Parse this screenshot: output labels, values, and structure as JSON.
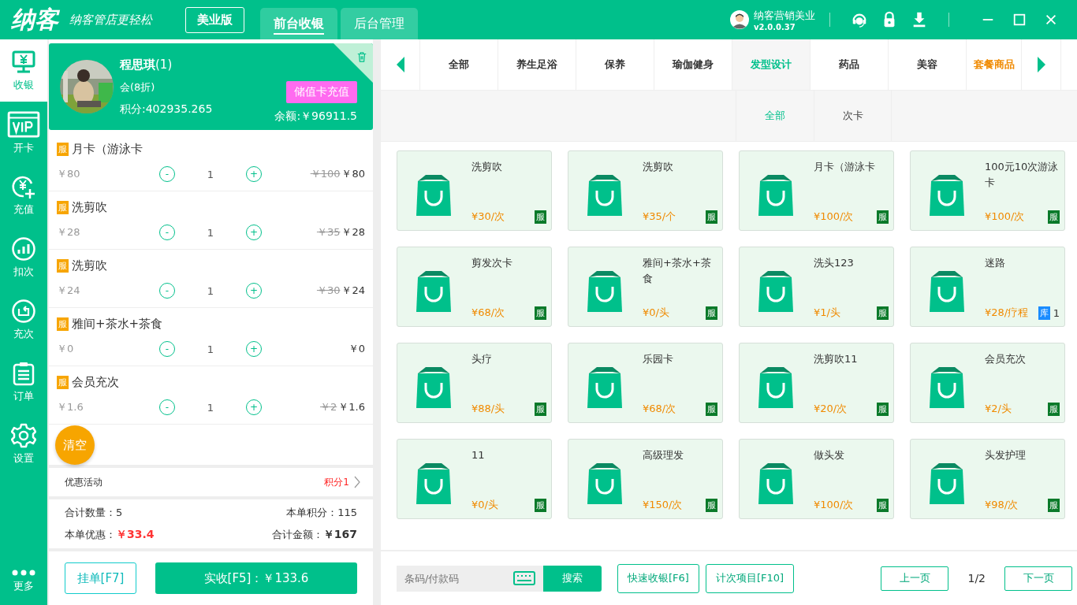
{
  "header": {
    "logo": "纳客",
    "slogan": "纳客管店更轻松",
    "edition": "美业版",
    "tabs": [
      {
        "label": "前台收银",
        "selected": true
      },
      {
        "label": "后台管理",
        "selected": false
      }
    ],
    "user": {
      "name": "纳客营销美业",
      "version": "v2.0.0.37"
    }
  },
  "nav": [
    {
      "label": "收银",
      "selected": true
    },
    {
      "label": "开卡",
      "selected": false
    },
    {
      "label": "充值",
      "selected": false
    },
    {
      "label": "扣次",
      "selected": false
    },
    {
      "label": "充次",
      "selected": false
    },
    {
      "label": "订单",
      "selected": false
    },
    {
      "label": "设置",
      "selected": false
    }
  ],
  "nav_more": "更多",
  "member": {
    "name": "程思琪",
    "count": "(1)",
    "level": "会(8折)",
    "recharge_button": "储值卡充值",
    "points": "积分:402935.265",
    "balance": "余额:￥96911.5"
  },
  "cart": [
    {
      "tag": "服",
      "name": "月卡（游泳卡",
      "unit_price": "￥80",
      "qty": "1",
      "original": "￥100",
      "price": "￥80"
    },
    {
      "tag": "服",
      "name": "洗剪吹",
      "unit_price": "￥28",
      "qty": "1",
      "original": "￥35",
      "price": "￥28"
    },
    {
      "tag": "服",
      "name": "洗剪吹",
      "unit_price": "￥24",
      "qty": "1",
      "original": "￥30",
      "price": "￥24"
    },
    {
      "tag": "服",
      "name": "雅间+茶水+茶食",
      "unit_price": "￥0",
      "qty": "1",
      "price": "￥0"
    },
    {
      "tag": "服",
      "name": "会员充次",
      "unit_price": "￥1.6",
      "qty": "1",
      "original": "￥2",
      "price": "￥1.6"
    }
  ],
  "minus": "-",
  "plus": "+",
  "clear_button": "清空",
  "promotion": {
    "label": "优惠活动",
    "value": "积分1"
  },
  "summary": {
    "qty_label": "合计数量：5",
    "points_label": "本单积分：115",
    "discount_label": "本单优惠：",
    "discount": "￥33.4",
    "total_label": "合计金额：",
    "total": "￥167"
  },
  "hold_button": "挂单[F7]",
  "pay_button": "实收[F5]：￥133.6",
  "categories": [
    {
      "label": "全部",
      "kind": "normal",
      "selected": false
    },
    {
      "label": "养生足浴",
      "kind": "normal",
      "selected": false
    },
    {
      "label": "保养",
      "kind": "normal",
      "selected": false
    },
    {
      "label": "瑜伽健身",
      "kind": "normal",
      "selected": false
    },
    {
      "label": "发型设计",
      "kind": "normal",
      "selected": true
    },
    {
      "label": "药品",
      "kind": "normal",
      "selected": false
    },
    {
      "label": "美容",
      "kind": "normal",
      "selected": false
    },
    {
      "label": "套餐商品",
      "kind": "package",
      "selected": false
    }
  ],
  "subcategories": [
    {
      "label": "全部",
      "selected": true
    },
    {
      "label": "次卡",
      "selected": false
    }
  ],
  "products": [
    {
      "name": "洗剪吹",
      "price": "¥30/次",
      "tag": "服",
      "kind": "service"
    },
    {
      "name": "洗剪吹",
      "price": "¥35/个",
      "tag": "服",
      "kind": "service"
    },
    {
      "name": "月卡（游泳卡",
      "price": "¥100/次",
      "tag": "服",
      "kind": "service"
    },
    {
      "name": "100元10次游泳卡",
      "price": "¥100/次",
      "tag": "服",
      "kind": "service"
    },
    {
      "name": "剪发次卡",
      "price": "¥68/次",
      "tag": "服",
      "kind": "service"
    },
    {
      "name": "雅间+茶水+茶食",
      "price": "¥0/头",
      "tag": "服",
      "kind": "service"
    },
    {
      "name": "洗头123",
      "price": "¥1/头",
      "tag": "服",
      "kind": "service"
    },
    {
      "name": "迷路",
      "price": "¥28/疗程",
      "tag": "库",
      "stock": "1",
      "kind": "stock"
    },
    {
      "name": "头疗",
      "price": "¥88/头",
      "tag": "服",
      "kind": "service"
    },
    {
      "name": "乐园卡",
      "price": "¥68/次",
      "tag": "服",
      "kind": "service"
    },
    {
      "name": "洗剪吹11",
      "price": "¥20/次",
      "tag": "服",
      "kind": "service"
    },
    {
      "name": "会员充次",
      "price": "¥2/头",
      "tag": "服",
      "kind": "service"
    },
    {
      "name": "11",
      "price": "¥0/头",
      "tag": "服",
      "kind": "service"
    },
    {
      "name": "高级理发",
      "price": "¥150/次",
      "tag": "服",
      "kind": "service"
    },
    {
      "name": "做头发",
      "price": "¥100/次",
      "tag": "服",
      "kind": "service"
    },
    {
      "name": "头发护理",
      "price": "¥98/次",
      "tag": "服",
      "kind": "service"
    }
  ],
  "footer": {
    "search_placeholder": "条码/付款码",
    "search_button": "搜索",
    "quick_button": "快速收银[F6]",
    "count_button": "计次项目[F10]",
    "prev": "上一页",
    "page": "1/2",
    "next": "下一页"
  }
}
